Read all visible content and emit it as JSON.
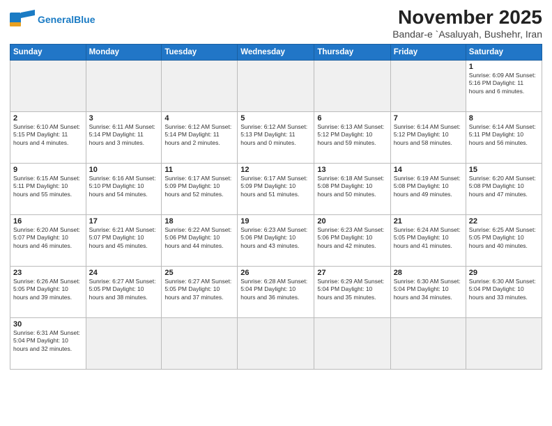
{
  "logo": {
    "text_general": "General",
    "text_blue": "Blue"
  },
  "title": "November 2025",
  "subtitle": "Bandar-e `Asaluyah, Bushehr, Iran",
  "weekdays": [
    "Sunday",
    "Monday",
    "Tuesday",
    "Wednesday",
    "Thursday",
    "Friday",
    "Saturday"
  ],
  "days": [
    {
      "num": "",
      "info": ""
    },
    {
      "num": "",
      "info": ""
    },
    {
      "num": "",
      "info": ""
    },
    {
      "num": "",
      "info": ""
    },
    {
      "num": "",
      "info": ""
    },
    {
      "num": "",
      "info": ""
    },
    {
      "num": "1",
      "info": "Sunrise: 6:09 AM\nSunset: 5:16 PM\nDaylight: 11 hours and 6 minutes."
    },
    {
      "num": "2",
      "info": "Sunrise: 6:10 AM\nSunset: 5:15 PM\nDaylight: 11 hours and 4 minutes."
    },
    {
      "num": "3",
      "info": "Sunrise: 6:11 AM\nSunset: 5:14 PM\nDaylight: 11 hours and 3 minutes."
    },
    {
      "num": "4",
      "info": "Sunrise: 6:12 AM\nSunset: 5:14 PM\nDaylight: 11 hours and 2 minutes."
    },
    {
      "num": "5",
      "info": "Sunrise: 6:12 AM\nSunset: 5:13 PM\nDaylight: 11 hours and 0 minutes."
    },
    {
      "num": "6",
      "info": "Sunrise: 6:13 AM\nSunset: 5:12 PM\nDaylight: 10 hours and 59 minutes."
    },
    {
      "num": "7",
      "info": "Sunrise: 6:14 AM\nSunset: 5:12 PM\nDaylight: 10 hours and 58 minutes."
    },
    {
      "num": "8",
      "info": "Sunrise: 6:14 AM\nSunset: 5:11 PM\nDaylight: 10 hours and 56 minutes."
    },
    {
      "num": "9",
      "info": "Sunrise: 6:15 AM\nSunset: 5:11 PM\nDaylight: 10 hours and 55 minutes."
    },
    {
      "num": "10",
      "info": "Sunrise: 6:16 AM\nSunset: 5:10 PM\nDaylight: 10 hours and 54 minutes."
    },
    {
      "num": "11",
      "info": "Sunrise: 6:17 AM\nSunset: 5:09 PM\nDaylight: 10 hours and 52 minutes."
    },
    {
      "num": "12",
      "info": "Sunrise: 6:17 AM\nSunset: 5:09 PM\nDaylight: 10 hours and 51 minutes."
    },
    {
      "num": "13",
      "info": "Sunrise: 6:18 AM\nSunset: 5:08 PM\nDaylight: 10 hours and 50 minutes."
    },
    {
      "num": "14",
      "info": "Sunrise: 6:19 AM\nSunset: 5:08 PM\nDaylight: 10 hours and 49 minutes."
    },
    {
      "num": "15",
      "info": "Sunrise: 6:20 AM\nSunset: 5:08 PM\nDaylight: 10 hours and 47 minutes."
    },
    {
      "num": "16",
      "info": "Sunrise: 6:20 AM\nSunset: 5:07 PM\nDaylight: 10 hours and 46 minutes."
    },
    {
      "num": "17",
      "info": "Sunrise: 6:21 AM\nSunset: 5:07 PM\nDaylight: 10 hours and 45 minutes."
    },
    {
      "num": "18",
      "info": "Sunrise: 6:22 AM\nSunset: 5:06 PM\nDaylight: 10 hours and 44 minutes."
    },
    {
      "num": "19",
      "info": "Sunrise: 6:23 AM\nSunset: 5:06 PM\nDaylight: 10 hours and 43 minutes."
    },
    {
      "num": "20",
      "info": "Sunrise: 6:23 AM\nSunset: 5:06 PM\nDaylight: 10 hours and 42 minutes."
    },
    {
      "num": "21",
      "info": "Sunrise: 6:24 AM\nSunset: 5:05 PM\nDaylight: 10 hours and 41 minutes."
    },
    {
      "num": "22",
      "info": "Sunrise: 6:25 AM\nSunset: 5:05 PM\nDaylight: 10 hours and 40 minutes."
    },
    {
      "num": "23",
      "info": "Sunrise: 6:26 AM\nSunset: 5:05 PM\nDaylight: 10 hours and 39 minutes."
    },
    {
      "num": "24",
      "info": "Sunrise: 6:27 AM\nSunset: 5:05 PM\nDaylight: 10 hours and 38 minutes."
    },
    {
      "num": "25",
      "info": "Sunrise: 6:27 AM\nSunset: 5:05 PM\nDaylight: 10 hours and 37 minutes."
    },
    {
      "num": "26",
      "info": "Sunrise: 6:28 AM\nSunset: 5:04 PM\nDaylight: 10 hours and 36 minutes."
    },
    {
      "num": "27",
      "info": "Sunrise: 6:29 AM\nSunset: 5:04 PM\nDaylight: 10 hours and 35 minutes."
    },
    {
      "num": "28",
      "info": "Sunrise: 6:30 AM\nSunset: 5:04 PM\nDaylight: 10 hours and 34 minutes."
    },
    {
      "num": "29",
      "info": "Sunrise: 6:30 AM\nSunset: 5:04 PM\nDaylight: 10 hours and 33 minutes."
    },
    {
      "num": "30",
      "info": "Sunrise: 6:31 AM\nSunset: 5:04 PM\nDaylight: 10 hours and 32 minutes."
    },
    {
      "num": "",
      "info": ""
    },
    {
      "num": "",
      "info": ""
    },
    {
      "num": "",
      "info": ""
    },
    {
      "num": "",
      "info": ""
    },
    {
      "num": "",
      "info": ""
    },
    {
      "num": "",
      "info": ""
    }
  ]
}
